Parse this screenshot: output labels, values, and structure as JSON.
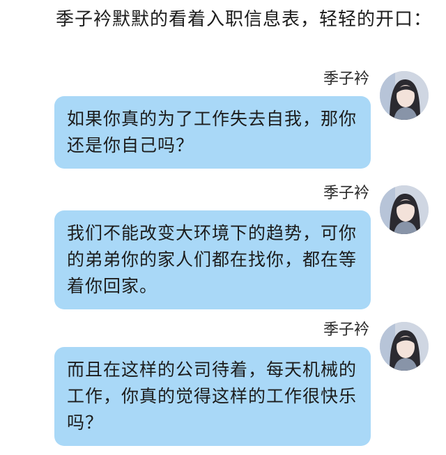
{
  "narration": "季子衿默默的看着入职信息表，轻轻的开口：",
  "messages": [
    {
      "sender": "季子衿",
      "avatar_icon": "profile-photo-avatar",
      "text": "如果你真的为了工作失去自我，那你还是你自己吗？"
    },
    {
      "sender": "季子衿",
      "avatar_icon": "profile-photo-avatar",
      "text": "我们不能改变大环境下的趋势，可你的弟弟你的家人们都在找你，都在等着你回家。"
    },
    {
      "sender": "季子衿",
      "avatar_icon": "profile-photo-avatar",
      "text": "而且在这样的公司待着，每天机械的工作，你真的觉得这样的工作很快乐吗？"
    }
  ],
  "colors": {
    "bubble": "#a9d8f7",
    "background": "#ffffff",
    "text": "#1c1c1c"
  }
}
